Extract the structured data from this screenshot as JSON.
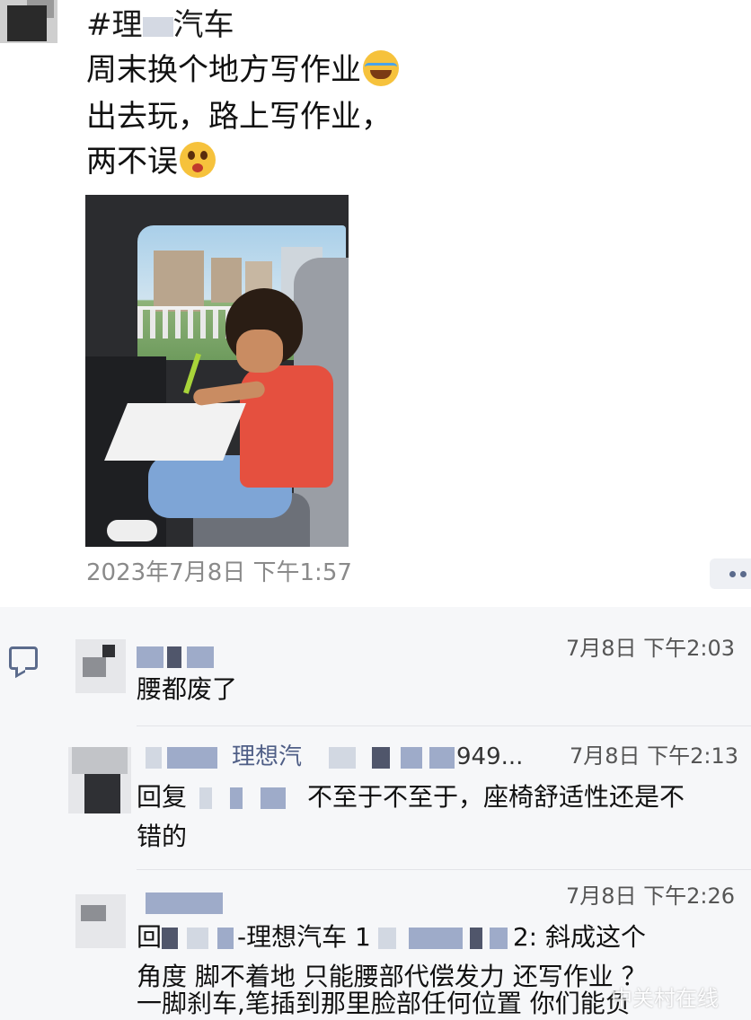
{
  "post": {
    "hashtag": "#理",
    "hashtag_tail": "汽车",
    "line1": "周末换个地方写作业",
    "line1_emoji": "laughing-with-tears-emoji",
    "line2": "出去玩，路上写作业，",
    "line3": "两不误",
    "line3_emoji": "surprised-face-emoji",
    "photo_description_icon": "child-writing-homework-in-car-photo",
    "timestamp": "2023年7月8日 下午1:57"
  },
  "comments": [
    {
      "time": "7月8日 下午2:03",
      "text": "腰都废了"
    },
    {
      "name_partial": "理想汽",
      "name_tail": "949...",
      "time": "7月8日 下午2:13",
      "reply_prefix": "回复",
      "text_line1": "不至于不至于，座椅舒适性还是不",
      "text_line2": "错的"
    },
    {
      "time": "7月8日 下午2:26",
      "reply_prefix": "回",
      "mid": "-理想汽车 1",
      "tail": "2: 斜成这个",
      "text_line2": "角度 脚不着地 只能腰部代偿发力 还写作业  ？",
      "text_line3": "一脚刹车,笔插到那里脸部任何位置 你们能负"
    }
  ],
  "watermark": "中关村在线",
  "colors": {
    "name_link": "#4f5e86",
    "timestamp": "#8a8a8a",
    "comments_bg": "#f6f7f9"
  }
}
